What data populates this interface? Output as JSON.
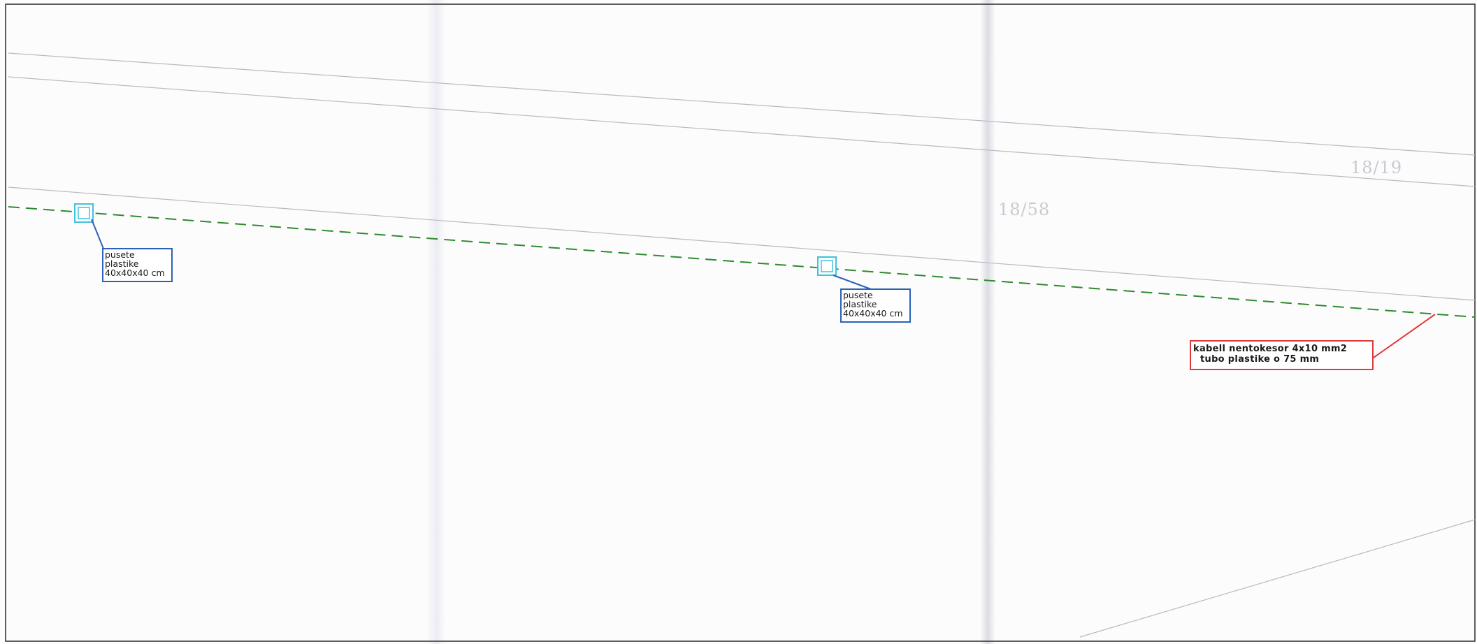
{
  "parcels": [
    {
      "id": "parcel-18-19",
      "label": "18/19"
    },
    {
      "id": "parcel-18-58",
      "label": "18/58"
    }
  ],
  "manholes": [
    {
      "id": "manhole-1",
      "lines": [
        "pusete",
        "plastike",
        "40x40x40 cm"
      ]
    },
    {
      "id": "manhole-2",
      "lines": [
        "pusete",
        "plastike",
        "40x40x40 cm"
      ]
    }
  ],
  "cable_label": {
    "line1": "kabell  nentokesor  4x10  mm2",
    "line2": "tubo  plastike  o  75  mm"
  },
  "colors": {
    "cable_line": "#2f8a2f",
    "manhole_symbol": "#3fc3dd",
    "manhole_label_border": "#2a62b8",
    "cable_label_border": "#e0393b",
    "parcel_boundary": "#b9b9c0",
    "parcel_number": "#c9cad1"
  }
}
